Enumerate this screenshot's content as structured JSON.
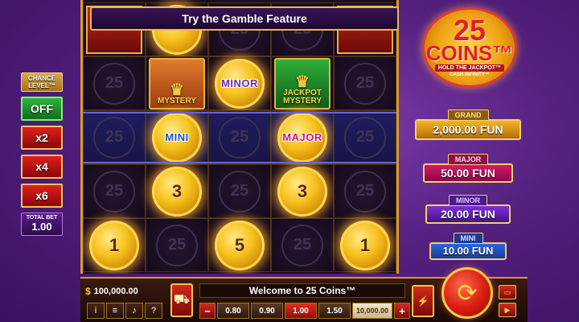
{
  "banner": {
    "text": "Try the Gamble Feature"
  },
  "chance": {
    "label": "CHANCE LEVEL™",
    "buttons": [
      "OFF",
      "x2",
      "x4",
      "x6"
    ],
    "total_bet_label": "TOTAL BET",
    "total_bet_value": "1.00"
  },
  "reels": {
    "row0": [
      "",
      "",
      "",
      "",
      ""
    ],
    "row1": {
      "mystery_left": "MYSTERY",
      "minor": "MINOR",
      "mystery_right": "JACKPOT MYSTERY"
    },
    "row2": {
      "mini": "MINI",
      "major": "MAJOR"
    },
    "row3": {
      "c2": "3",
      "c4": "3"
    },
    "row4": {
      "c1": "1",
      "c3": "5",
      "c5": "1"
    },
    "empty_coin": "25"
  },
  "logo": {
    "number": "25",
    "word": "COINS™",
    "sub": "HOLD THE JACKPOT™",
    "sub2": "CASH INFINITY™"
  },
  "jackpots": {
    "grand": {
      "label": "GRAND",
      "value": "2,000.00 FUN"
    },
    "major": {
      "label": "MAJOR",
      "value": "50.00 FUN"
    },
    "minor": {
      "label": "MINOR",
      "value": "20.00 FUN"
    },
    "mini": {
      "label": "MINI",
      "value": "10.00 FUN"
    }
  },
  "bottom": {
    "balance": "100,000.00",
    "message": "Welcome to 25 Coins™",
    "bets": [
      "0.80",
      "0.90",
      "1.00",
      "1.50",
      "10,000.00"
    ],
    "active_bet": "1.00",
    "minus": "−",
    "plus": "+"
  }
}
